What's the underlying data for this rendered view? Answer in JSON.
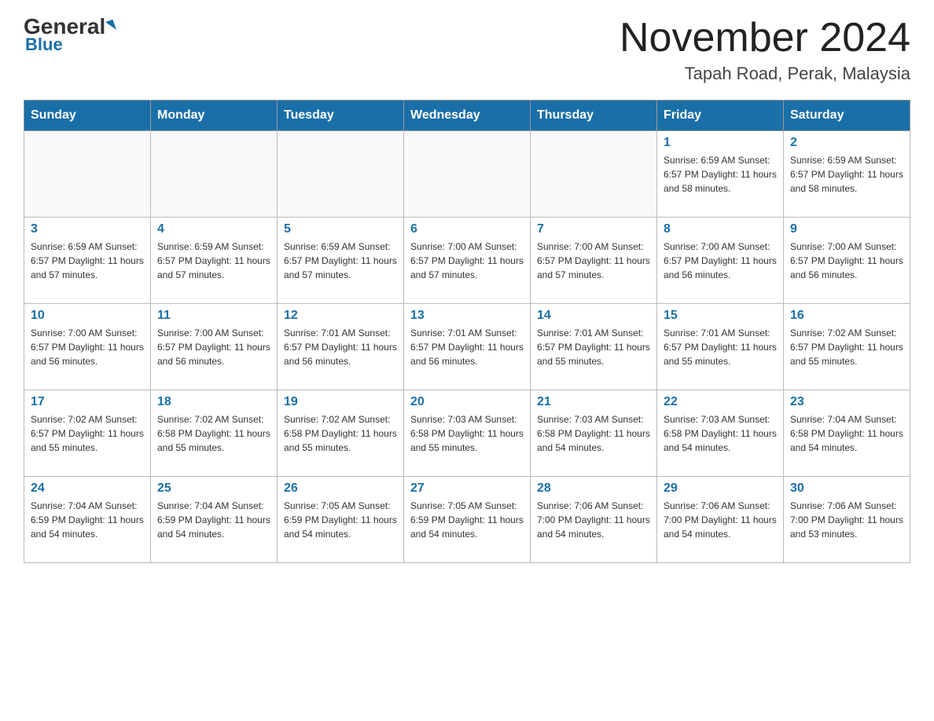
{
  "header": {
    "logo_general": "General",
    "logo_blue": "Blue",
    "month_title": "November 2024",
    "location": "Tapah Road, Perak, Malaysia"
  },
  "days_of_week": [
    "Sunday",
    "Monday",
    "Tuesday",
    "Wednesday",
    "Thursday",
    "Friday",
    "Saturday"
  ],
  "weeks": [
    [
      {
        "day": "",
        "info": ""
      },
      {
        "day": "",
        "info": ""
      },
      {
        "day": "",
        "info": ""
      },
      {
        "day": "",
        "info": ""
      },
      {
        "day": "",
        "info": ""
      },
      {
        "day": "1",
        "info": "Sunrise: 6:59 AM\nSunset: 6:57 PM\nDaylight: 11 hours\nand 58 minutes."
      },
      {
        "day": "2",
        "info": "Sunrise: 6:59 AM\nSunset: 6:57 PM\nDaylight: 11 hours\nand 58 minutes."
      }
    ],
    [
      {
        "day": "3",
        "info": "Sunrise: 6:59 AM\nSunset: 6:57 PM\nDaylight: 11 hours\nand 57 minutes."
      },
      {
        "day": "4",
        "info": "Sunrise: 6:59 AM\nSunset: 6:57 PM\nDaylight: 11 hours\nand 57 minutes."
      },
      {
        "day": "5",
        "info": "Sunrise: 6:59 AM\nSunset: 6:57 PM\nDaylight: 11 hours\nand 57 minutes."
      },
      {
        "day": "6",
        "info": "Sunrise: 7:00 AM\nSunset: 6:57 PM\nDaylight: 11 hours\nand 57 minutes."
      },
      {
        "day": "7",
        "info": "Sunrise: 7:00 AM\nSunset: 6:57 PM\nDaylight: 11 hours\nand 57 minutes."
      },
      {
        "day": "8",
        "info": "Sunrise: 7:00 AM\nSunset: 6:57 PM\nDaylight: 11 hours\nand 56 minutes."
      },
      {
        "day": "9",
        "info": "Sunrise: 7:00 AM\nSunset: 6:57 PM\nDaylight: 11 hours\nand 56 minutes."
      }
    ],
    [
      {
        "day": "10",
        "info": "Sunrise: 7:00 AM\nSunset: 6:57 PM\nDaylight: 11 hours\nand 56 minutes."
      },
      {
        "day": "11",
        "info": "Sunrise: 7:00 AM\nSunset: 6:57 PM\nDaylight: 11 hours\nand 56 minutes."
      },
      {
        "day": "12",
        "info": "Sunrise: 7:01 AM\nSunset: 6:57 PM\nDaylight: 11 hours\nand 56 minutes."
      },
      {
        "day": "13",
        "info": "Sunrise: 7:01 AM\nSunset: 6:57 PM\nDaylight: 11 hours\nand 56 minutes."
      },
      {
        "day": "14",
        "info": "Sunrise: 7:01 AM\nSunset: 6:57 PM\nDaylight: 11 hours\nand 55 minutes."
      },
      {
        "day": "15",
        "info": "Sunrise: 7:01 AM\nSunset: 6:57 PM\nDaylight: 11 hours\nand 55 minutes."
      },
      {
        "day": "16",
        "info": "Sunrise: 7:02 AM\nSunset: 6:57 PM\nDaylight: 11 hours\nand 55 minutes."
      }
    ],
    [
      {
        "day": "17",
        "info": "Sunrise: 7:02 AM\nSunset: 6:57 PM\nDaylight: 11 hours\nand 55 minutes."
      },
      {
        "day": "18",
        "info": "Sunrise: 7:02 AM\nSunset: 6:58 PM\nDaylight: 11 hours\nand 55 minutes."
      },
      {
        "day": "19",
        "info": "Sunrise: 7:02 AM\nSunset: 6:58 PM\nDaylight: 11 hours\nand 55 minutes."
      },
      {
        "day": "20",
        "info": "Sunrise: 7:03 AM\nSunset: 6:58 PM\nDaylight: 11 hours\nand 55 minutes."
      },
      {
        "day": "21",
        "info": "Sunrise: 7:03 AM\nSunset: 6:58 PM\nDaylight: 11 hours\nand 54 minutes."
      },
      {
        "day": "22",
        "info": "Sunrise: 7:03 AM\nSunset: 6:58 PM\nDaylight: 11 hours\nand 54 minutes."
      },
      {
        "day": "23",
        "info": "Sunrise: 7:04 AM\nSunset: 6:58 PM\nDaylight: 11 hours\nand 54 minutes."
      }
    ],
    [
      {
        "day": "24",
        "info": "Sunrise: 7:04 AM\nSunset: 6:59 PM\nDaylight: 11 hours\nand 54 minutes."
      },
      {
        "day": "25",
        "info": "Sunrise: 7:04 AM\nSunset: 6:59 PM\nDaylight: 11 hours\nand 54 minutes."
      },
      {
        "day": "26",
        "info": "Sunrise: 7:05 AM\nSunset: 6:59 PM\nDaylight: 11 hours\nand 54 minutes."
      },
      {
        "day": "27",
        "info": "Sunrise: 7:05 AM\nSunset: 6:59 PM\nDaylight: 11 hours\nand 54 minutes."
      },
      {
        "day": "28",
        "info": "Sunrise: 7:06 AM\nSunset: 7:00 PM\nDaylight: 11 hours\nand 54 minutes."
      },
      {
        "day": "29",
        "info": "Sunrise: 7:06 AM\nSunset: 7:00 PM\nDaylight: 11 hours\nand 54 minutes."
      },
      {
        "day": "30",
        "info": "Sunrise: 7:06 AM\nSunset: 7:00 PM\nDaylight: 11 hours\nand 53 minutes."
      }
    ]
  ]
}
